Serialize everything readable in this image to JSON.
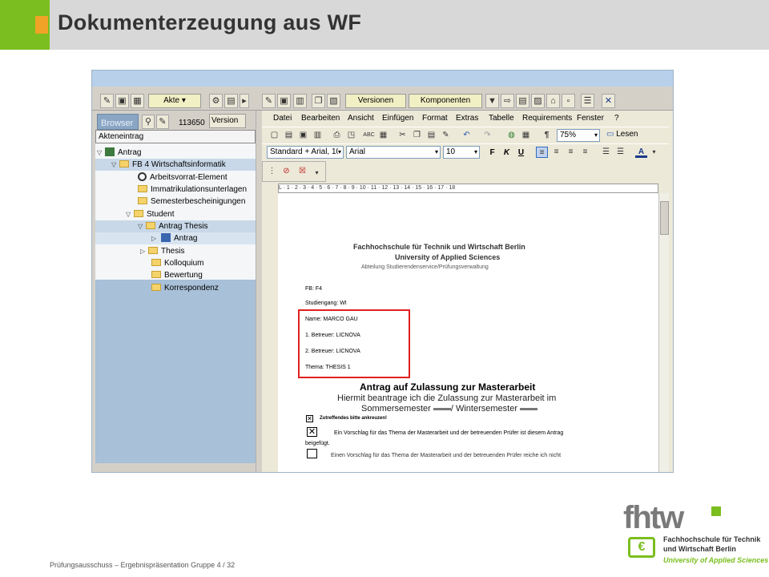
{
  "slide": {
    "title": "Dokumenterzeugung aus WF",
    "footer": "Prüfungsausschuss – Ergebnispräsentation Gruppe 4  /  32"
  },
  "logo": {
    "mark": "fhtw",
    "line1": "Fachhochschule für Technik",
    "line2": "und Wirtschaft Berlin",
    "line3": "University of Applied Sciences",
    "euro": "€"
  },
  "colors": {
    "accent_green": "#7bbe1f",
    "accent_orange": "#f0a326",
    "selection": "#f6c342",
    "highlight_box": "#e02020"
  },
  "sap_toolbar": {
    "akte": "Akte",
    "versionen": "Versionen",
    "komponenten": "Komponenten"
  },
  "left_panel": {
    "browser": "Browser",
    "number": "113650",
    "version": "Version",
    "label": "Akteneintrag",
    "tree": [
      {
        "label": "Antrag",
        "icon": "document-tree-icon"
      },
      {
        "label": "FB 4 Wirtschaftsinformatik",
        "icon": "folder-icon"
      },
      {
        "label": "Arbeitsvorrat-Element",
        "icon": "workitem-icon"
      },
      {
        "label": "Immatrikulationsunterlagen",
        "icon": "folder-icon"
      },
      {
        "label": "Semesterbescheinigungen",
        "icon": "folder-icon"
      },
      {
        "label": "Student",
        "icon": "folder-icon"
      },
      {
        "label": "Antrag Thesis",
        "icon": "folder-icon"
      },
      {
        "label": "Antrag",
        "icon": "word-document-icon"
      },
      {
        "label": "Thesis",
        "icon": "folder-icon"
      },
      {
        "label": "Kolloquium",
        "icon": "folder-icon"
      },
      {
        "label": "Bewertung",
        "icon": "folder-icon"
      },
      {
        "label": "Korrespondenz",
        "icon": "folder-icon"
      }
    ]
  },
  "word": {
    "menu": [
      "Datei",
      "Bearbeiten",
      "Ansicht",
      "Einfügen",
      "Format",
      "Extras",
      "Tabelle",
      "Requirements",
      "Fenster",
      "?"
    ],
    "zoom": "75%",
    "lesen": "Lesen",
    "style": "Standard + Arial, 10",
    "font": "Arial",
    "size": "10",
    "bold": "F",
    "italic": "K",
    "underline": "U",
    "ruler": "L  ·  1  ·  2  ·  3  ·  4  ·  5  ·  6  ·  7  ·  8  ·  9  ·  10  ·  11  ·  12  ·  13  ·  14  ·  15  ·  16  ·  17  ·  18"
  },
  "document": {
    "school1": "Fachhochschule für Technik und Wirtschaft Berlin",
    "school2": "University of Applied Sciences",
    "dept": "Abteilung Studierendenservice/Prüfungsverwaltung",
    "fb": "FB: F4",
    "studiengang": "Studiengang: WI",
    "name": "Name: MARCO GAU",
    "betreuer1": "1. Betreuer: LICNOVA",
    "betreuer2": "2. Betreuer: LICNOVA",
    "thema": "Thema:  THESIS 1",
    "heading": "Antrag auf Zulassung zur Masterarbeit",
    "line1": "Hiermit beantrage ich die Zulassung zur Masterarbeit im",
    "line2a": "Sommersemester",
    "line2b": "/ Wintersemester",
    "hint": "Zutreffendes bitte ankreuzen!",
    "option1a": "Ein Vorschlag für das Thema der Masterarbeit und der betreuenden Prüfer ist diesem Antrag",
    "option1b": "beigefügt.",
    "option2": "Einen Vorschlag für das Thema der Masterarbeit und der betreuenden Prüfer reiche ich nicht"
  }
}
